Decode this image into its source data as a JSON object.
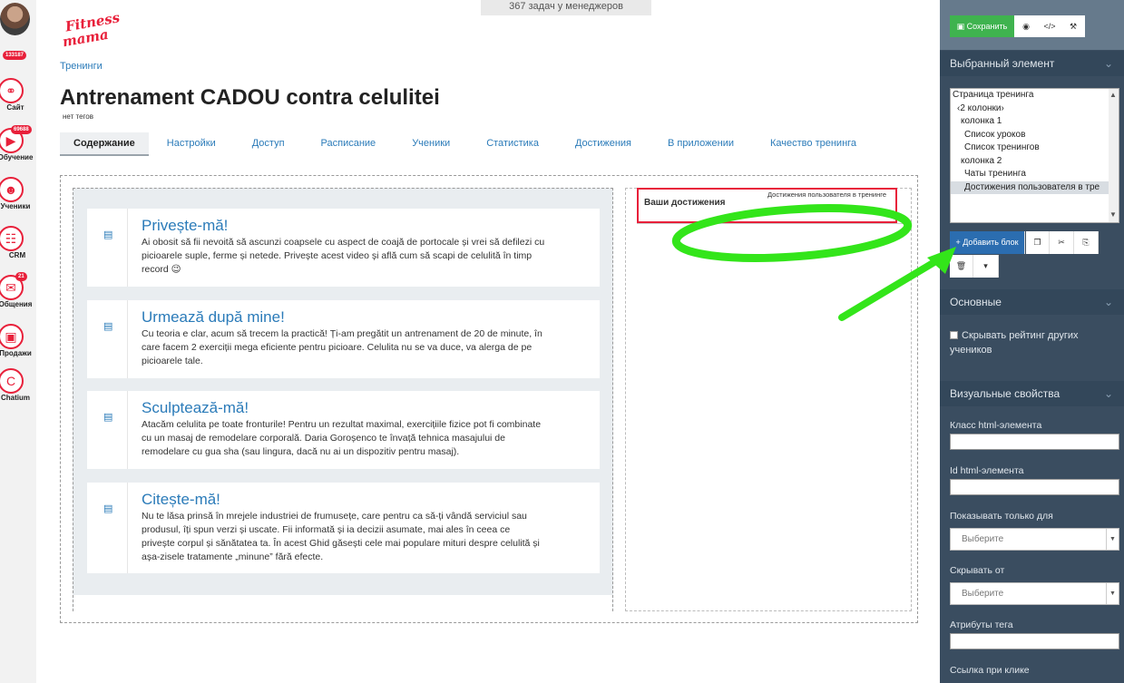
{
  "nav": {
    "profile_badge": "133187",
    "items": [
      {
        "label": "Сайт",
        "icon": "globe-icon",
        "badge": ""
      },
      {
        "label": "Обучение",
        "icon": "video-lesson-icon",
        "badge": "69688"
      },
      {
        "label": "Ученики",
        "icon": "students-icon",
        "badge": ""
      },
      {
        "label": "CRM",
        "icon": "crm-icon",
        "badge": ""
      },
      {
        "label": "Общения",
        "icon": "chat-icon",
        "badge": "21"
      },
      {
        "label": "Продажи",
        "icon": "wallet-icon",
        "badge": ""
      },
      {
        "label": "Chatium",
        "icon": "chatium-icon",
        "badge": ""
      }
    ]
  },
  "header": {
    "logo_text_1": "Fitness",
    "logo_text_2": "mama",
    "tasks": "367 задач у менеджеров",
    "breadcrumb": "Тренинги",
    "title": "Antrenament CADOU contra celulitei",
    "tags": "нет тегов"
  },
  "tabs": [
    {
      "label": "Содержание",
      "active": true
    },
    {
      "label": "Настройки"
    },
    {
      "label": "Доступ"
    },
    {
      "label": "Расписание"
    },
    {
      "label": "Ученики"
    },
    {
      "label": "Статистика"
    },
    {
      "label": "Достижения"
    },
    {
      "label": "В приложении"
    },
    {
      "label": "Качество тренинга"
    }
  ],
  "lessons": [
    {
      "title": "Privește-mă!",
      "desc": "Ai obosit să fii nevoită să ascunzi coapsele cu aspect de coajă de portocale și vrei să defilezi cu picioarele suple, ferme și netede. Privește acest video și află cum să scapi de celulită în timp record 😉"
    },
    {
      "title": "Urmează după mine!",
      "desc": "Cu teoria e clar, acum să trecem la practică! Ți-am pregătit un antrenament de 20 de minute, în care facem 2 exerciții mega eficiente pentru picioare. Celulita nu se va duce, va alerga de pe picioarele tale."
    },
    {
      "title": "Sculptează-mă!",
      "desc": "Atacăm celulita pe toate fronturile! Pentru un rezultat maximal, exercițiile fizice pot fi combinate cu un masaj de remodelare corporală. Daria Goroșenco te învață tehnica masajului de remodelare cu gua sha (sau lingura, dacă nu ai un dispozitiv pentru masaj)."
    },
    {
      "title": "Citește-mă!",
      "desc": "Nu te lăsa prinsă în mrejele industriei de frumusețe, care pentru ca să-ți vândă serviciul sau produsul, îți spun verzi și uscate. Fii informată și ia decizii asumate, mai ales în ceea ce privește corpul și sănătatea ta. În acest Ghid găsești cele mai populare mituri despre celulită și așa-zisele tratamente „minune” fără efecte."
    }
  ],
  "achievements": {
    "tag": "Достижения пользователя в тренинге",
    "title": "Ваши достижения"
  },
  "panel": {
    "save_label": "Сохранить",
    "selected_header": "Выбранный элемент",
    "tree": [
      "Страница тренинга",
      "‹2 колонки›",
      "колонка 1",
      "Список уроков",
      "Список тренингов",
      "колонка 2",
      "Чаты тренинга",
      "Достижения пользователя в тре"
    ],
    "add_block_label": "Добавить блок",
    "basic_header": "Основные",
    "hide_rating_label": "Скрывать рейтинг других учеников",
    "visual_header": "Визуальные свойства",
    "class_label": "Класс html-элемента",
    "id_label": "Id html-элемента",
    "show_only_label": "Показывать только для",
    "show_only_placeholder": "Выберите",
    "hide_from_label": "Скрывать от",
    "hide_from_placeholder": "Выберите",
    "tag_attrs_label": "Атрибуты тега",
    "link_label": "Ссылка при клике"
  },
  "colors": {
    "accent": "#e8203a",
    "link": "#2b7bb9",
    "panel": "#3a4d60",
    "save": "#3fb34f",
    "annotation": "#33e51a"
  }
}
